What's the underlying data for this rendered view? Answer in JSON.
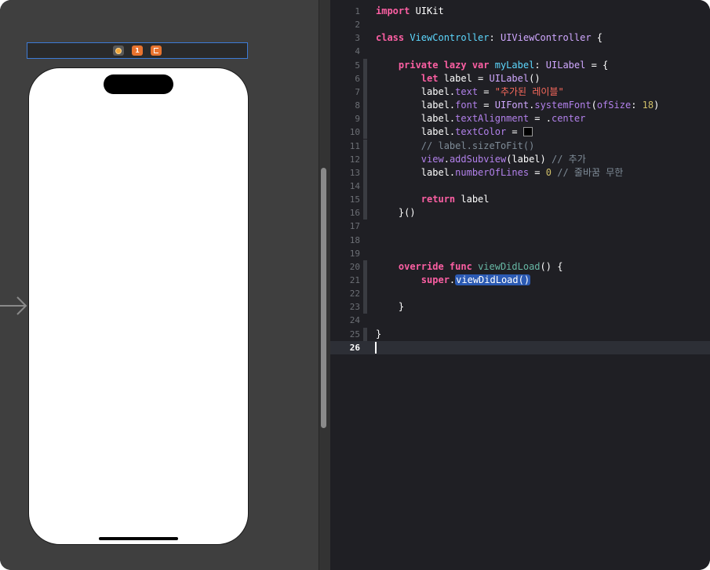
{
  "storyboard": {
    "scene_dock_icons": [
      "view-controller-icon",
      "first-responder-icon",
      "exit-icon"
    ],
    "entry_point_icon": "initial-view-controller-arrow-icon"
  },
  "editor": {
    "current_line": 26,
    "lines": [
      {
        "n": "1",
        "segs": [
          {
            "t": "import",
            "c": "kw"
          },
          {
            "t": " UIKit",
            "c": "pl"
          }
        ]
      },
      {
        "n": "2",
        "segs": []
      },
      {
        "n": "3",
        "segs": [
          {
            "t": "class",
            "c": "kw"
          },
          {
            "t": " ",
            "c": "pl"
          },
          {
            "t": "ViewController",
            "c": "tp"
          },
          {
            "t": ": ",
            "c": "pl"
          },
          {
            "t": "UIViewController",
            "c": "ty"
          },
          {
            "t": " {",
            "c": "pl"
          }
        ]
      },
      {
        "n": "4",
        "segs": []
      },
      {
        "n": "5",
        "segs": [
          {
            "t": "    ",
            "c": "pl"
          },
          {
            "t": "private lazy var",
            "c": "kw"
          },
          {
            "t": " ",
            "c": "pl"
          },
          {
            "t": "myLabel",
            "c": "tp"
          },
          {
            "t": ": ",
            "c": "pl"
          },
          {
            "t": "UILabel",
            "c": "ty"
          },
          {
            "t": " = {",
            "c": "pl"
          }
        ]
      },
      {
        "n": "6",
        "segs": [
          {
            "t": "        ",
            "c": "pl"
          },
          {
            "t": "let",
            "c": "kw"
          },
          {
            "t": " label = ",
            "c": "pl"
          },
          {
            "t": "UILabel",
            "c": "ty"
          },
          {
            "t": "()",
            "c": "pl"
          }
        ]
      },
      {
        "n": "7",
        "segs": [
          {
            "t": "        label.",
            "c": "pl"
          },
          {
            "t": "text",
            "c": "pr"
          },
          {
            "t": " = ",
            "c": "pl"
          },
          {
            "t": "\"추가된 레이블\"",
            "c": "str"
          }
        ]
      },
      {
        "n": "8",
        "segs": [
          {
            "t": "        label.",
            "c": "pl"
          },
          {
            "t": "font",
            "c": "pr"
          },
          {
            "t": " = ",
            "c": "pl"
          },
          {
            "t": "UIFont",
            "c": "ty"
          },
          {
            "t": ".",
            "c": "pl"
          },
          {
            "t": "systemFont",
            "c": "pr"
          },
          {
            "t": "(",
            "c": "pl"
          },
          {
            "t": "ofSize",
            "c": "pr"
          },
          {
            "t": ": ",
            "c": "pl"
          },
          {
            "t": "18",
            "c": "num"
          },
          {
            "t": ")",
            "c": "pl"
          }
        ]
      },
      {
        "n": "9",
        "segs": [
          {
            "t": "        label.",
            "c": "pl"
          },
          {
            "t": "textAlignment",
            "c": "pr"
          },
          {
            "t": " = .",
            "c": "pl"
          },
          {
            "t": "center",
            "c": "pr"
          }
        ]
      },
      {
        "n": "10",
        "segs": [
          {
            "t": "        label.",
            "c": "pl"
          },
          {
            "t": "textColor",
            "c": "pr"
          },
          {
            "t": " = ",
            "c": "pl"
          },
          {
            "t": "",
            "c": "swatch"
          }
        ]
      },
      {
        "n": "11",
        "segs": [
          {
            "t": "        ",
            "c": "pl"
          },
          {
            "t": "// label.sizeToFit()",
            "c": "cm"
          }
        ]
      },
      {
        "n": "12",
        "segs": [
          {
            "t": "        ",
            "c": "pl"
          },
          {
            "t": "view",
            "c": "pr"
          },
          {
            "t": ".",
            "c": "pl"
          },
          {
            "t": "addSubview",
            "c": "pr"
          },
          {
            "t": "(label) ",
            "c": "pl"
          },
          {
            "t": "// 추가",
            "c": "cm"
          }
        ]
      },
      {
        "n": "13",
        "segs": [
          {
            "t": "        label.",
            "c": "pl"
          },
          {
            "t": "numberOfLines",
            "c": "pr"
          },
          {
            "t": " = ",
            "c": "pl"
          },
          {
            "t": "0",
            "c": "num"
          },
          {
            "t": " ",
            "c": "pl"
          },
          {
            "t": "// 줄바꿈 무한",
            "c": "cm"
          }
        ]
      },
      {
        "n": "14",
        "segs": []
      },
      {
        "n": "15",
        "segs": [
          {
            "t": "        ",
            "c": "pl"
          },
          {
            "t": "return",
            "c": "kw"
          },
          {
            "t": " label",
            "c": "pl"
          }
        ]
      },
      {
        "n": "16",
        "segs": [
          {
            "t": "    }()",
            "c": "pl"
          }
        ]
      },
      {
        "n": "17",
        "segs": []
      },
      {
        "n": "18",
        "segs": []
      },
      {
        "n": "19",
        "segs": []
      },
      {
        "n": "20",
        "segs": [
          {
            "t": "    ",
            "c": "pl"
          },
          {
            "t": "override func",
            "c": "kw"
          },
          {
            "t": " ",
            "c": "pl"
          },
          {
            "t": "viewDidLoad",
            "c": "fn"
          },
          {
            "t": "() {",
            "c": "pl"
          }
        ]
      },
      {
        "n": "21",
        "segs": [
          {
            "t": "        ",
            "c": "pl"
          },
          {
            "t": "super",
            "c": "kw"
          },
          {
            "t": ".",
            "c": "pl"
          },
          {
            "t": "viewDidLoad()",
            "c": "sel"
          }
        ]
      },
      {
        "n": "22",
        "segs": []
      },
      {
        "n": "23",
        "segs": [
          {
            "t": "    }",
            "c": "pl"
          }
        ]
      },
      {
        "n": "24",
        "segs": []
      },
      {
        "n": "25",
        "segs": [
          {
            "t": "}",
            "c": "pl"
          }
        ]
      },
      {
        "n": "26",
        "segs": []
      }
    ]
  }
}
